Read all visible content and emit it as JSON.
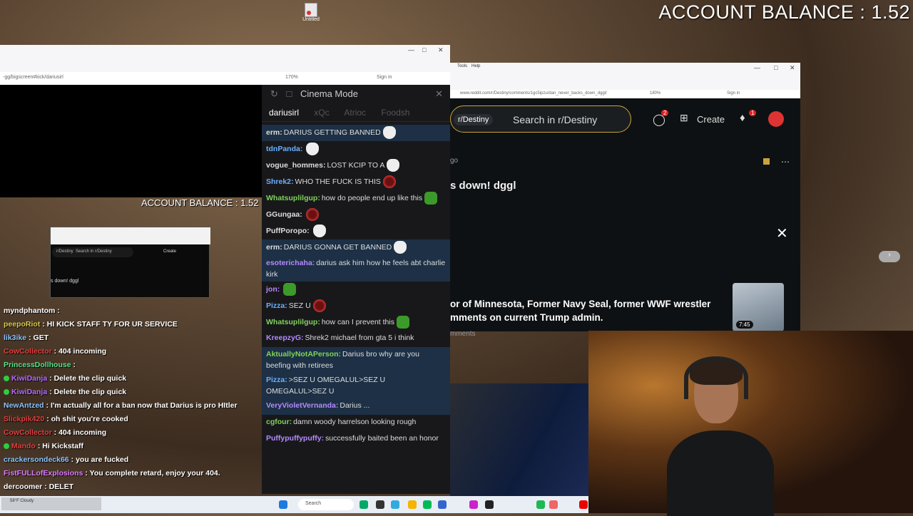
{
  "overlay": {
    "balance_top": "ACCOUNT BALANCE : 1.52",
    "balance_mid": "ACCOUNT BALANCE : 1.52"
  },
  "desktop": {
    "icon_label": "Untitled"
  },
  "left_browser": {
    "url": "-gg/bigscreen#kick/dariusirl",
    "zoom": "170%",
    "signin": "Sign in"
  },
  "mini_window": {
    "subreddit": "r/Destiny",
    "search": "Search in r/Destiny",
    "create": "Create",
    "post_title": "s down! dggl"
  },
  "left_chat": [
    {
      "user": "myndphantom",
      "text": ":",
      "color": "#ffffff",
      "badge": false
    },
    {
      "user": "peepoRiot",
      "text": ": HI KICK STAFF TY FOR UR SERVICE",
      "color": "#d9c94a",
      "badge": false
    },
    {
      "user": "lik3ike",
      "text": ": GET",
      "color": "#8bc4ff",
      "badge": false
    },
    {
      "user": "CowCollector",
      "text": ": 404 incoming",
      "color": "#e04040",
      "badge": false
    },
    {
      "user": "PrincessDollhouse",
      "text": ":",
      "color": "#5fe08a",
      "badge": false
    },
    {
      "user": "KiwiDanja",
      "text": ": Delete the clip quick",
      "color": "#b76cff",
      "badge": true
    },
    {
      "user": "KiwiDanja",
      "text": ": Delete the clip quick",
      "color": "#b76cff",
      "badge": true
    },
    {
      "user": "NewAntzed",
      "text": ": I'm actually all for a ban now that Darius is pro HItler",
      "color": "#8bc4ff",
      "badge": false
    },
    {
      "user": "Slickpik420",
      "text": ": oh shit you're cooked",
      "color": "#e04040",
      "badge": false
    },
    {
      "user": "CowCollector",
      "text": ": 404 incoming",
      "color": "#e04040",
      "badge": false
    },
    {
      "user": "Mando",
      "text": ": Hi Kickstaff",
      "color": "#e04040",
      "badge": true
    },
    {
      "user": "crackersondeck66",
      "text": ": you are fucked",
      "color": "#8bc4ff",
      "badge": false
    },
    {
      "user": "FistFULLofExplosions",
      "text": ": You complete retard, enjoy your 404.",
      "color": "#e07cff",
      "badge": false
    },
    {
      "user": "dercoomer",
      "text": ": DELET",
      "color": "#ffffff",
      "badge": false
    }
  ],
  "cinema": {
    "title": "Cinema Mode",
    "tabs": [
      "dariusirl",
      "xQc",
      "Atrioc",
      "Foodsh"
    ],
    "messages": [
      {
        "user": "erm:",
        "text": "DARIUS GETTING BANNED",
        "color": "#dddddd",
        "hl": true,
        "emote": "e-sk"
      },
      {
        "user": "tdnPanda:",
        "text": "",
        "color": "#6ab0ff",
        "hl": false,
        "emote": "e-sk"
      },
      {
        "user": "vogue_hommes:",
        "text": "LOST KCIP TO A",
        "color": "#dddddd",
        "hl": false,
        "emote": "e-sk"
      },
      {
        "user": "Shrek2:",
        "text": "WHO THE FUCK IS THIS",
        "color": "#6ab0ff",
        "hl": false,
        "emote": "e-red"
      },
      {
        "user": "Whatsuplilgup:",
        "text": "how do people end up like this",
        "color": "#7fd35a",
        "hl": false,
        "emote": "e-gr"
      },
      {
        "user": "GGungaa:",
        "text": "",
        "color": "#dddddd",
        "hl": false,
        "emote": "e-red"
      },
      {
        "user": "PuffPoropo:",
        "text": "",
        "color": "#dddddd",
        "hl": false,
        "emote": "e-sk"
      },
      {
        "user": "erm:",
        "text": "DARIUS GONNA GET BANNED",
        "color": "#dddddd",
        "hl": true,
        "emote": "e-sk"
      },
      {
        "user": "esoterichaha:",
        "text": "darius ask him how he feels abt charlie kirk",
        "color": "#b48aff",
        "hl": true,
        "emote": ""
      },
      {
        "user": "jon:",
        "text": "",
        "color": "#b48aff",
        "hl": false,
        "emote": "e-gr"
      },
      {
        "user": "Pizza:",
        "text": "SEZ U",
        "color": "#6ab0ff",
        "hl": false,
        "emote": "e-red"
      },
      {
        "user": "Whatsuplilgup:",
        "text": "how can I prevent this",
        "color": "#7fd35a",
        "hl": false,
        "emote": "e-gr"
      },
      {
        "user": "KreepzyG:",
        "text": "Shrek2 michael from gta 5 i think",
        "color": "#b48aff",
        "hl": false,
        "emote": ""
      },
      {
        "user": "AktuallyNotAPerson:",
        "text": "Darius bro why are you beefing with retirees",
        "color": "#7fd35a",
        "hl": true,
        "emote": ""
      },
      {
        "user": "Pizza:",
        "text": ">SEZ U OMEGALUL>SEZ U OMEGALUL>SEZ U",
        "color": "#6ab0ff",
        "hl": true,
        "emote": ""
      },
      {
        "user": "VeryVioletVernanda:",
        "text": "Darius ...",
        "color": "#b48aff",
        "hl": true,
        "emote": ""
      },
      {
        "user": "cgfour:",
        "text": "damn woody harrelson looking rough",
        "color": "#7fd35a",
        "hl": false,
        "emote": ""
      },
      {
        "user": "Puffypuffypuffy:",
        "text": "successfully baited been an honor",
        "color": "#b48aff",
        "hl": false,
        "emote": ""
      }
    ]
  },
  "reddit": {
    "url": "www.reddit.com/r/Destiny/comments/1gc5ipzu/dan_never_backs_down_dggl/",
    "zoom": "180%",
    "signin": "Sign in",
    "menu": [
      "Tools",
      "Help"
    ],
    "subreddit": "r/Destiny",
    "search": "Search in r/Destiny",
    "create": "Create",
    "chat_badge": "2",
    "notif_badge": "1",
    "time_ago": "go",
    "post_title": "s down! dggl",
    "news_line1": "or of Minnesota, Former Navy Seal, former WWF wrestler",
    "news_line2": "mments on current Trump admin.",
    "comments": "mments",
    "video_len": "7:45"
  },
  "taskbar": {
    "search": "Search",
    "weather": "58°F Cloudy"
  }
}
